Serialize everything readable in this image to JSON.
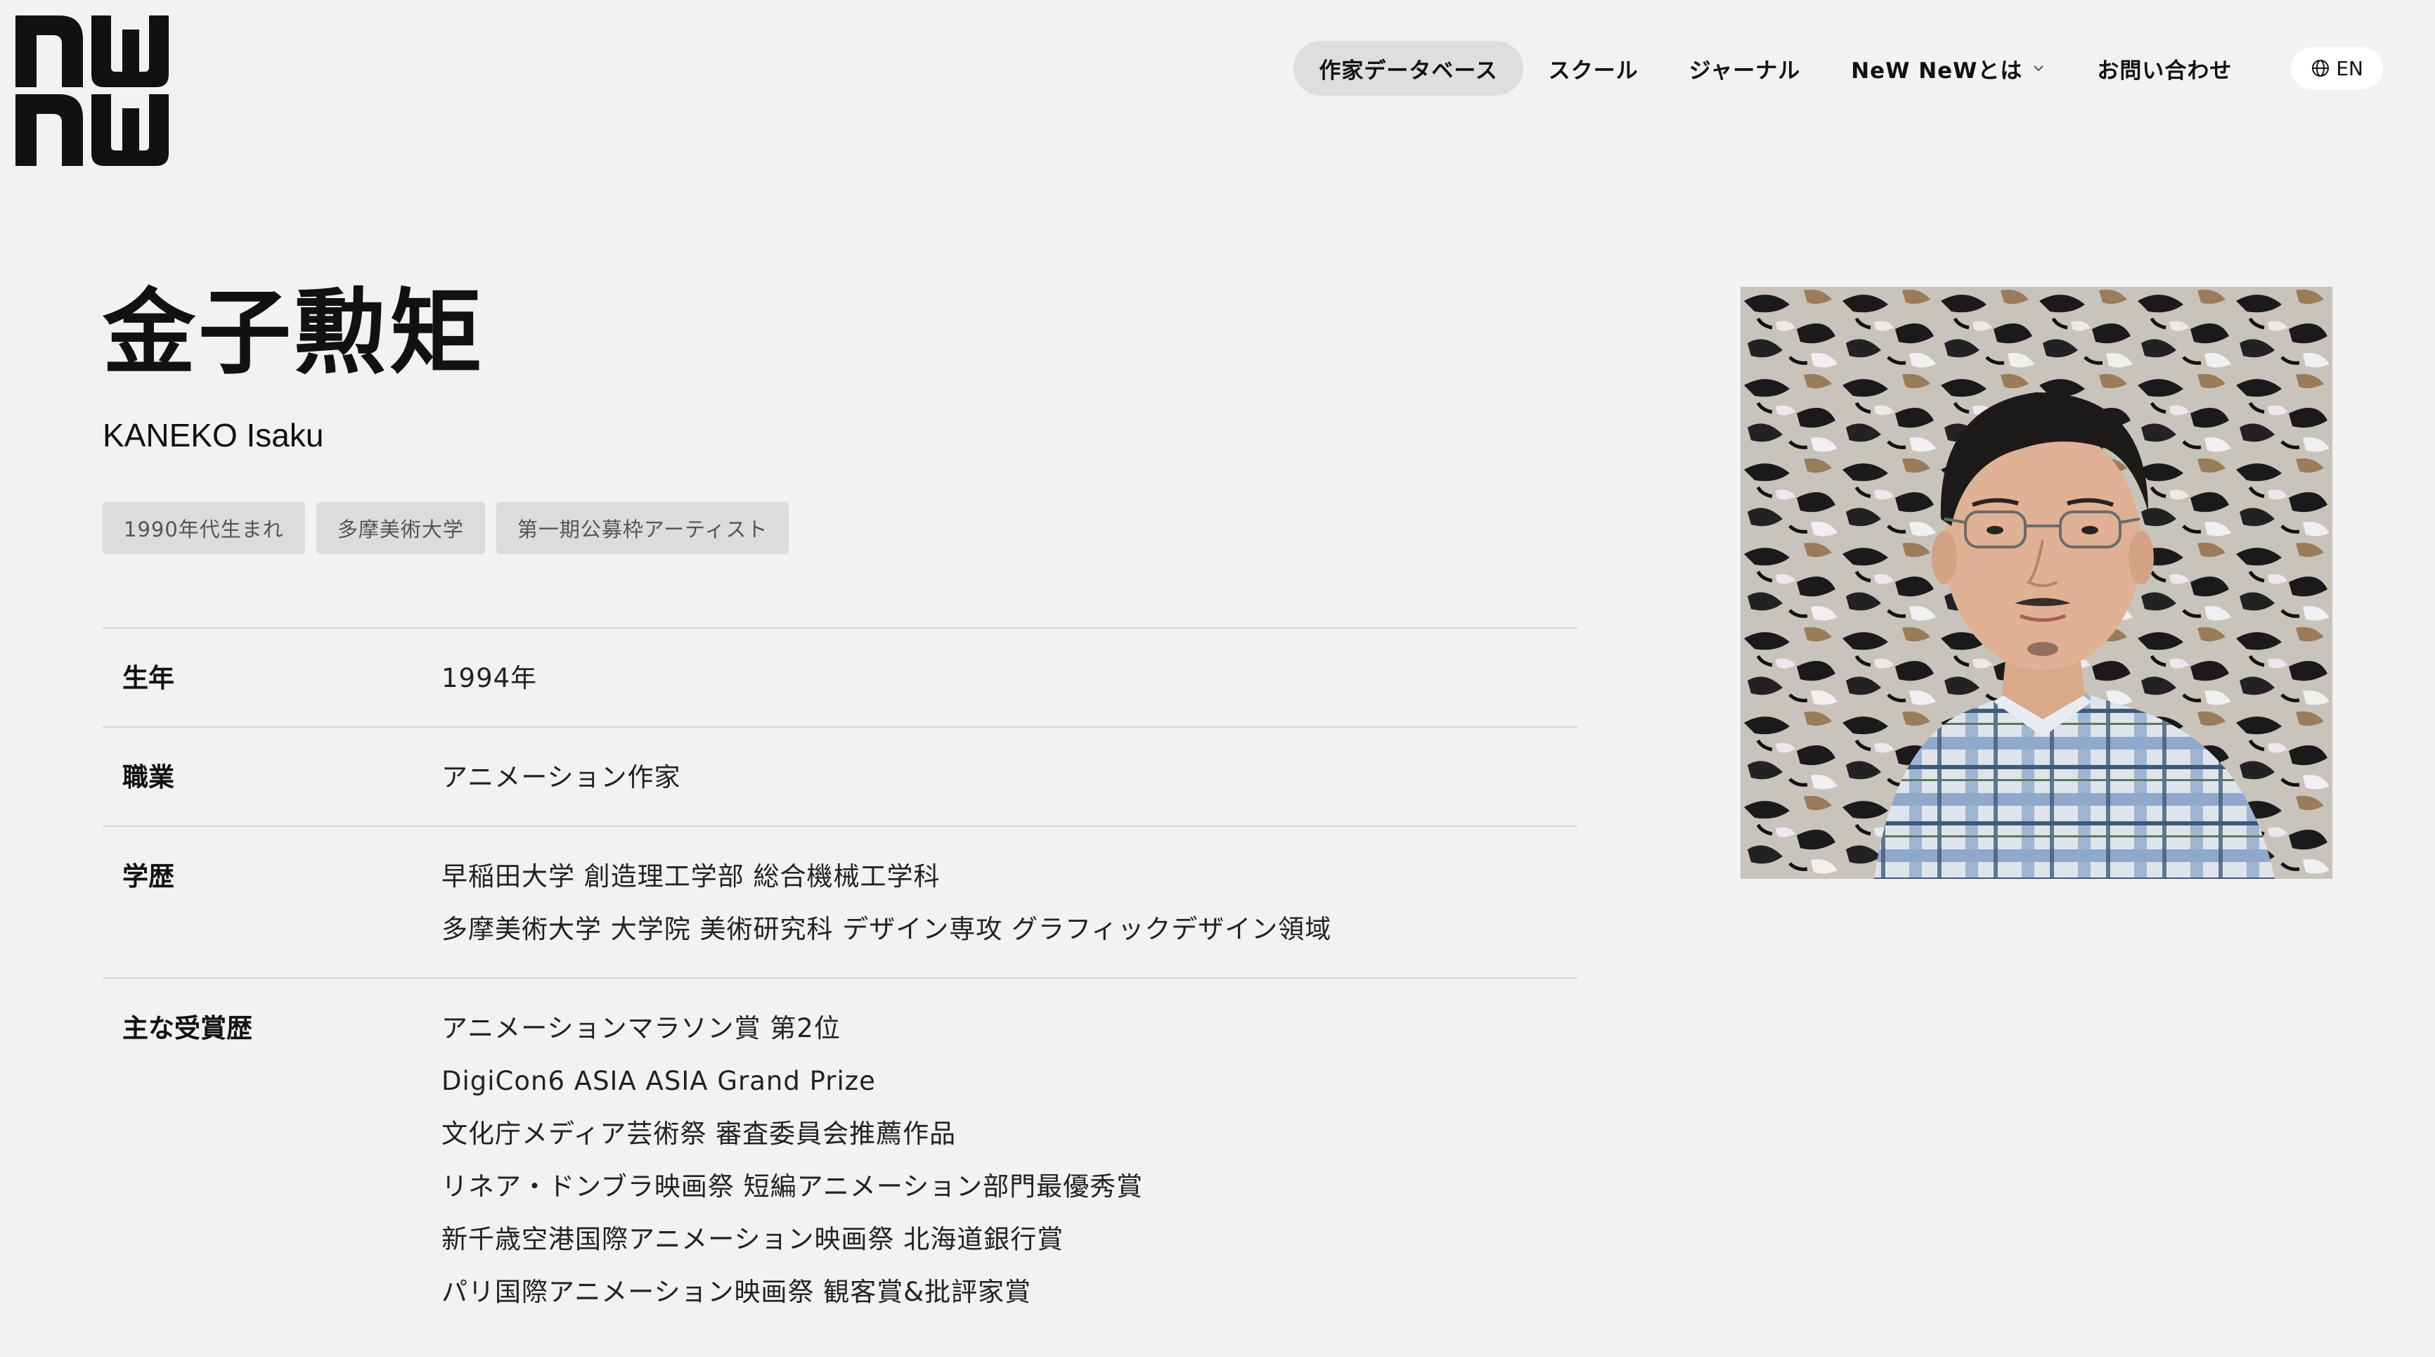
{
  "nav": {
    "items": [
      {
        "label": "作家データベース",
        "active": true
      },
      {
        "label": "スクール",
        "active": false
      },
      {
        "label": "ジャーナル",
        "active": false
      },
      {
        "label": "NeW NeWとは",
        "active": false,
        "dropdown": true
      },
      {
        "label": "お問い合わせ",
        "active": false
      }
    ],
    "lang_label": "EN"
  },
  "profile": {
    "name_ja": "金子勲矩",
    "name_en": "KANEKO Isaku",
    "tags": [
      "1990年代生まれ",
      "多摩美術大学",
      "第一期公募枠アーティスト"
    ],
    "rows": [
      {
        "label": "生年",
        "values": [
          "1994年"
        ]
      },
      {
        "label": "職業",
        "values": [
          "アニメーション作家"
        ]
      },
      {
        "label": "学歴",
        "values": [
          "早稲田大学 創造理工学部 総合機械工学科",
          "多摩美術大学 大学院 美術研究科 デザイン専攻 グラフィックデザイン領域"
        ]
      },
      {
        "label": "主な受賞歴",
        "values": [
          "アニメーションマラソン賞 第2位",
          "DigiCon6 ASIA ASIA Grand Prize",
          "文化庁メディア芸術祭 審査委員会推薦作品",
          "リネア・ドンブラ映画祭 短編アニメーション部門最優秀賞",
          "新千歳空港国際アニメーション映画祭 北海道銀行賞",
          "パリ国際アニメーション映画祭 観客賞&批評家賞"
        ]
      }
    ]
  },
  "colors": {
    "background": "#f2f2f2",
    "nav_active": "#dedede",
    "tag_bg": "#dcdcdc",
    "divider": "#d7d7d7"
  }
}
